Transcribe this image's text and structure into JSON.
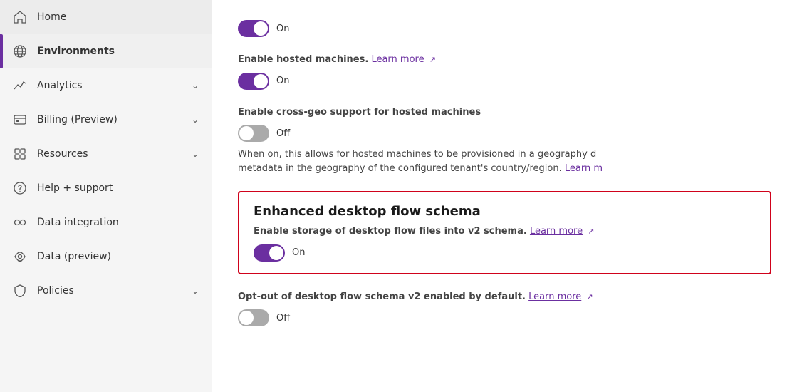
{
  "sidebar": {
    "items": [
      {
        "id": "home",
        "label": "Home",
        "icon": "home",
        "active": false,
        "hasChevron": false
      },
      {
        "id": "environments",
        "label": "Environments",
        "icon": "globe",
        "active": true,
        "hasChevron": false
      },
      {
        "id": "analytics",
        "label": "Analytics",
        "icon": "chart",
        "active": false,
        "hasChevron": true
      },
      {
        "id": "billing",
        "label": "Billing (Preview)",
        "icon": "billing",
        "active": false,
        "hasChevron": true
      },
      {
        "id": "resources",
        "label": "Resources",
        "icon": "resources",
        "active": false,
        "hasChevron": true
      },
      {
        "id": "help",
        "label": "Help + support",
        "icon": "help",
        "active": false,
        "hasChevron": false
      },
      {
        "id": "data-integration",
        "label": "Data integration",
        "icon": "data-integration",
        "active": false,
        "hasChevron": false
      },
      {
        "id": "data-preview",
        "label": "Data (preview)",
        "icon": "data-preview",
        "active": false,
        "hasChevron": false
      },
      {
        "id": "policies",
        "label": "Policies",
        "icon": "policies",
        "active": false,
        "hasChevron": true
      }
    ]
  },
  "main": {
    "settings": [
      {
        "id": "hosted-machines",
        "title": "",
        "desc": "Enable hosted machines.",
        "learn_more": "Learn more",
        "toggle_state": "on",
        "toggle_label": "On",
        "has_highlight": false
      },
      {
        "id": "cross-geo",
        "title": "",
        "desc": "Enable cross-geo support for hosted machines",
        "learn_more": "",
        "toggle_state": "off",
        "toggle_label": "Off",
        "sub_desc": "When on, this allows for hosted machines to be provisioned in a geography different from the geography of the metadata in the geography of the configured tenant's country/region.",
        "sub_learn_more": "Learn m",
        "has_highlight": false
      },
      {
        "id": "enhanced-desktop",
        "title": "Enhanced desktop flow schema",
        "desc": "Enable storage of desktop flow files into v2 schema.",
        "learn_more": "Learn more",
        "toggle_state": "on",
        "toggle_label": "On",
        "has_highlight": true
      },
      {
        "id": "opt-out",
        "title": "",
        "desc": "Opt-out of desktop flow schema v2 enabled by default.",
        "learn_more": "Learn more",
        "toggle_state": "off",
        "toggle_label": "Off",
        "has_highlight": false
      }
    ]
  }
}
